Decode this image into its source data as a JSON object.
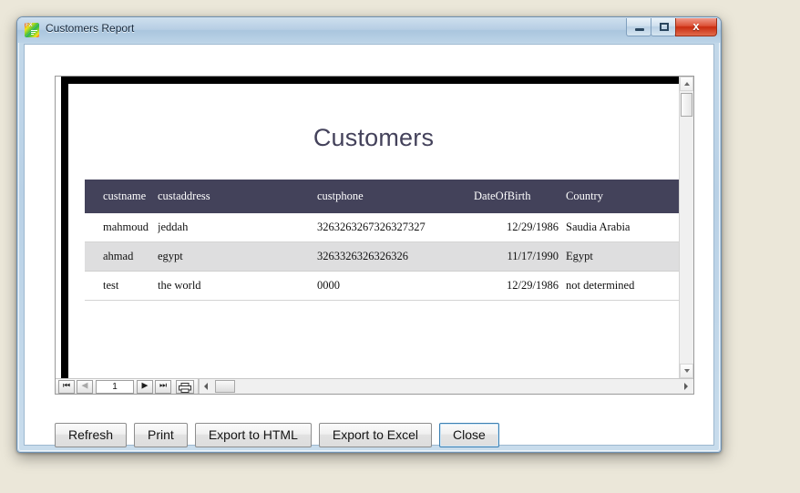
{
  "window": {
    "title": "Customers Report",
    "icon": "app-gradient-icon",
    "minimize_label": "",
    "maximize_label": "",
    "close_label": "x"
  },
  "report": {
    "title": "Customers",
    "columns": [
      "custname",
      "custaddress",
      "custphone",
      "DateOfBirth",
      "Country"
    ],
    "rows": [
      {
        "custname": "mahmoud",
        "custaddress": "jeddah",
        "custphone": "3263263267326327327",
        "DateOfBirth": "12/29/1986",
        "Country": "Saudia Arabia"
      },
      {
        "custname": "ahmad",
        "custaddress": "egypt",
        "custphone": "3263326326326326",
        "DateOfBirth": "11/17/1990",
        "Country": "Egypt"
      },
      {
        "custname": "test",
        "custaddress": "the world",
        "custphone": "0000",
        "DateOfBirth": "12/29/1986",
        "Country": "not determined"
      }
    ],
    "header_bg": "#43425a",
    "alt_row_bg": "#dededf",
    "title_color": "#44425b"
  },
  "pager": {
    "first_label": "⏮",
    "prev_label": "◀",
    "page_value": "1",
    "next_label": "▶",
    "last_label": "⏭",
    "print_label": "print-icon"
  },
  "buttons": [
    {
      "label": "Refresh",
      "name": "refresh-button",
      "focused": false
    },
    {
      "label": "Print",
      "name": "print-button",
      "focused": false
    },
    {
      "label": "Export to HTML",
      "name": "export-html-button",
      "focused": false
    },
    {
      "label": "Export to Excel",
      "name": "export-excel-button",
      "focused": false
    },
    {
      "label": "Close",
      "name": "close-button",
      "focused": true
    }
  ],
  "theme": {
    "desktop_bg": "#ebe7d9",
    "titlebar_accent": "#b6cee4",
    "close_button": "#c92c10",
    "focus_blue": "#3c7fb1"
  }
}
